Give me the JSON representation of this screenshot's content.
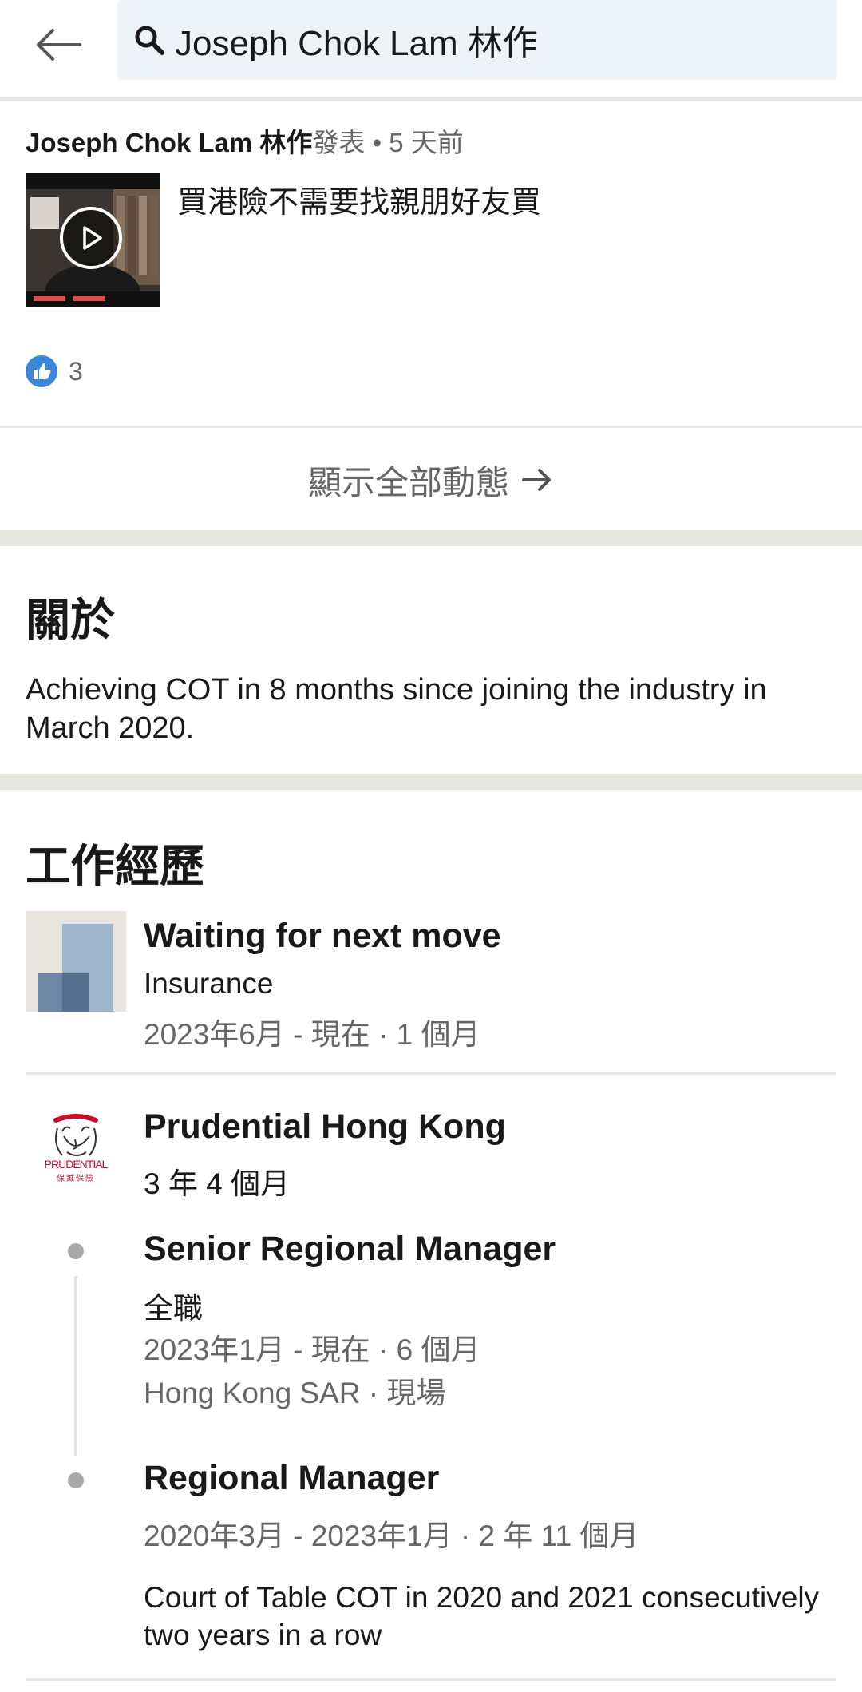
{
  "search": {
    "query": "Joseph Chok Lam 林作"
  },
  "post": {
    "author": "Joseph Chok Lam 林作",
    "action": "發表",
    "time": " • 5 天前",
    "text": "買港險不需要找親朋好友買",
    "likes": "3"
  },
  "show_all_label": "顯示全部動態",
  "about": {
    "title": "關於",
    "text": "Achieving COT in 8 months since joining the industry in March 2020."
  },
  "experience": {
    "title": "工作經歷",
    "items": [
      {
        "title": "Waiting for next move",
        "company": "Insurance",
        "dates": "2023年6月 - 現在 · 1 個月"
      },
      {
        "company": "Prudential Hong Kong",
        "logo_text": "PRUDENTIAL",
        "logo_sub": "保誠保險",
        "duration": "3 年 4 個月",
        "roles": [
          {
            "title": "Senior Regional Manager",
            "type": "全職",
            "dates": "2023年1月 - 現在 · 6 個月",
            "location": "Hong Kong SAR · 現場"
          },
          {
            "title": "Regional Manager",
            "dates": "2020年3月 - 2023年1月 · 2 年 11 個月",
            "description": "Court of Table COT in 2020 and 2021 consecutively two years in a row"
          }
        ]
      }
    ]
  },
  "colors": {
    "accent": "#3a86d9",
    "divider": "#e8e6e1",
    "search_bg": "#eef3f8",
    "prudential_red": "#c8102e"
  }
}
